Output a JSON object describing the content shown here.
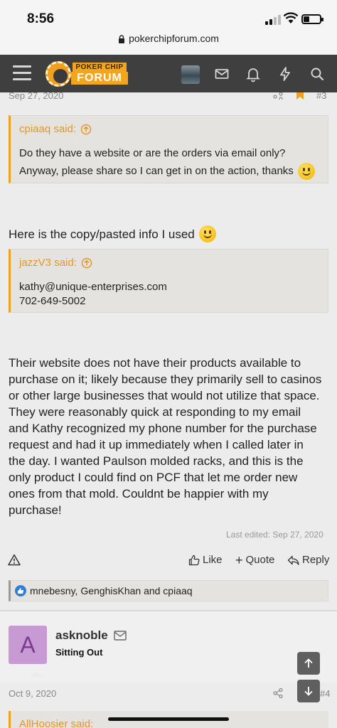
{
  "status": {
    "time": "8:56"
  },
  "browser": {
    "url": "pokerchipforum.com"
  },
  "nav": {
    "logo_top": "POKER CHIP",
    "logo_bottom": "FORUM"
  },
  "post1": {
    "date": "Sep 27, 2020",
    "number": "#3",
    "quote1": {
      "author": "cpiaaq said:",
      "line1": "Do they have a website or are the orders via email only?",
      "line2": "Anyway, please share so I can get in on the action, thanks"
    },
    "intro": "Here is the copy/pasted info I used",
    "quote2": {
      "author": "jazzV3 said:",
      "line1": "kathy@unique-enterprises.com",
      "line2": "702-649-5002"
    },
    "body": [
      "Their website does not have their products available to",
      "purchase on it; likely because they primarily sell to casinos",
      "or other large businesses that would not utilize that space.",
      "They were reasonably quick at responding to my email",
      "and Kathy recognized my phone number for the purchase",
      "request and had it up immediately when I called later in",
      "the day. I wanted Paulson molded racks, and this is the",
      "only product I could find on PCF that let me order new",
      "ones from that mold. Couldnt be happier with my",
      "purchase!"
    ],
    "edited": "Last edited: Sep 27, 2020",
    "actions": {
      "like": "Like",
      "quote": "Quote",
      "reply": "Reply"
    },
    "reactions": "mnebesny, GenghisKhan and cpiaaq"
  },
  "post2": {
    "avatar_letter": "A",
    "username": "asknoble",
    "user_title": "Sitting Out",
    "date": "Oct 9, 2020",
    "number": "#4",
    "quote_author": "AllHoosier said:"
  }
}
